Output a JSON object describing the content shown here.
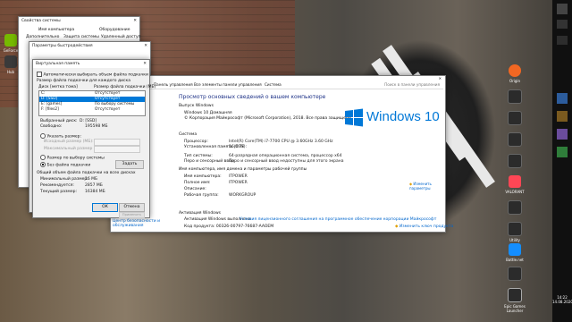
{
  "desktop": {
    "right_icons": [
      {
        "label": "Origin",
        "color": "#f26722"
      },
      {
        "label": "",
        "color": "#2b2b2b"
      },
      {
        "label": "",
        "color": "#2b2b2b"
      },
      {
        "label": "",
        "color": "#2b2b2b"
      },
      {
        "label": "",
        "color": "#2b2b2b"
      },
      {
        "label": "VALORANT",
        "color": "#ff4655"
      },
      {
        "label": "",
        "color": "#2b2b2b"
      },
      {
        "label": "Utility",
        "color": "#2b2b2b"
      },
      {
        "label": "Battle.net",
        "color": "#148eff"
      },
      {
        "label": "",
        "color": "#2b2b2b"
      },
      {
        "label": "Epic Games Launcher",
        "color": "#2b2b2b"
      }
    ],
    "left_icons": [
      {
        "label": "GeForce",
        "color": "#76b900"
      },
      {
        "label": "Hub",
        "color": "#3a3a3a"
      }
    ]
  },
  "clock": {
    "time": "14:22",
    "date": "14.08.2020"
  },
  "sys_props_back": {
    "title": "Свойства системы",
    "tabs": [
      "Имя компьютера",
      "Оборудование",
      "Дополнительно",
      "Защита системы",
      "Удаленный доступ"
    ]
  },
  "perf_back": {
    "title": "Параметры быстродействия"
  },
  "vmem": {
    "title": "Виртуальная память",
    "auto_checkbox": "Автоматически выбирать объем файла подкачки",
    "group_label": "Размер файла подкачки для каждого диска",
    "col_disk": "Диск [метка тома]",
    "col_size": "Размер файла подкачки (МБ)",
    "drives": [
      {
        "disk": "C:",
        "size": "Отсутствует"
      },
      {
        "disk": "D:        [SSD]",
        "size": "Отсутствует"
      },
      {
        "disk": "E:        [games]",
        "size": "По выбору системы"
      },
      {
        "disk": "F:        [files2]",
        "size": "Отсутствует"
      }
    ],
    "selected_disk_label": "Выбранный диск:",
    "selected_disk_value": "D:  [SSD]",
    "free_label": "Свободно:",
    "free_value": "195598 МБ",
    "custom_radio": "Указать размер:",
    "initial_label": "Исходный размер (МБ):",
    "max_label": "Максимальный размер (МБ):",
    "system_radio": "Размер по выбору системы",
    "none_radio": "Без файла подкачки",
    "set_button": "Задать",
    "total_group": "Общий объем файла подкачки на всех дисках",
    "min_label": "Минимальный размер:",
    "min_value": "16 МБ",
    "rec_label": "Рекомендуется:",
    "rec_value": "2857 МБ",
    "cur_label": "Текущий размер:",
    "cur_value": "16384 МБ",
    "ok": "ОК",
    "cancel": "Отмена",
    "apply": "Применить"
  },
  "system_win": {
    "title": "Система",
    "breadcrumb": [
      "Панель управления",
      "Все элементы панели управления",
      "Система"
    ],
    "search_placeholder": "Поиск в панели управления",
    "left_links": [
      "Центр безопасности и обслуживания"
    ],
    "left_see_also": "См. также",
    "heading": "Просмотр основных сведений о вашем компьютере",
    "edition_section": "Выпуск Windows",
    "edition": "Windows 10 Домашняя",
    "copyright": "© Корпорация Майкрософт (Microsoft Corporation), 2018. Все права защищены.",
    "system_section": "Система",
    "rows": [
      {
        "k": "Процессор:",
        "v": "Intel(R) Core(TM) i7-7700 CPU @ 3.60GHz   3.60 GHz"
      },
      {
        "k": "Установленная память (ОЗУ):",
        "v": "16,0 ГБ"
      },
      {
        "k": "Тип системы:",
        "v": "64-разрядная операционная система, процессор x64"
      },
      {
        "k": "Перо и сенсорный ввод:",
        "v": "Перо и сенсорный ввод недоступны для этого экрана"
      }
    ],
    "name_section": "Имя компьютера, имя домена и параметры рабочей группы",
    "name_rows": [
      {
        "k": "Имя компьютера:",
        "v": "ITPOWER"
      },
      {
        "k": "Полное имя:",
        "v": "ITPOWER"
      },
      {
        "k": "Описание:",
        "v": ""
      },
      {
        "k": "Рабочая группа:",
        "v": "WORKGROUP"
      }
    ],
    "change_params": "Изменить параметры",
    "activation_section": "Активация Windows",
    "activation_text": "Активация Windows выполнена",
    "license_link": "Условия лицензионного соглашения на программное обеспечение корпорации Майкрософт",
    "product_key": "Код продукта: 00326-00797-76687-AAOEM",
    "change_key": "Изменить ключ продукта",
    "logo_text": "Windows 10"
  }
}
